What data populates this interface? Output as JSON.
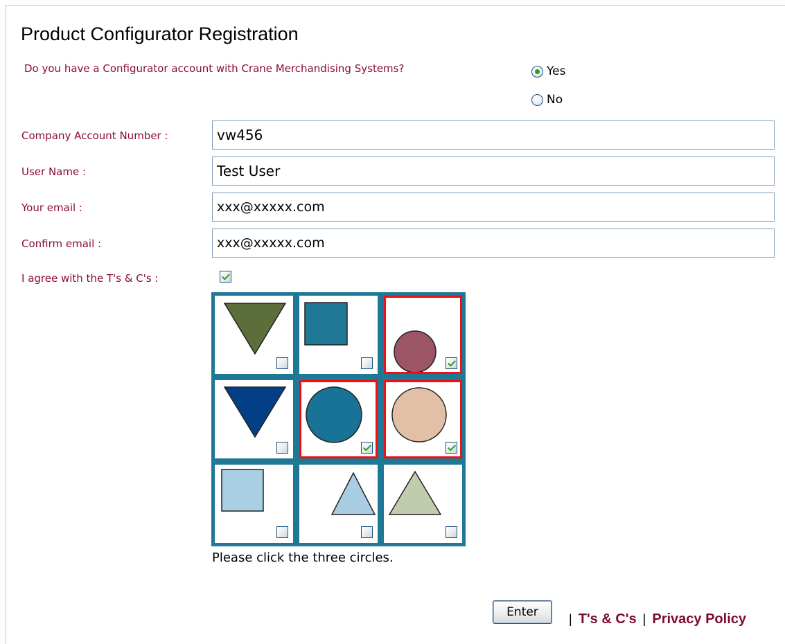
{
  "page": {
    "title": "Product Configurator Registration",
    "question": "Do you have a Configurator account with Crane Merchandising Systems?",
    "account_options": [
      {
        "label": "Yes",
        "selected": true
      },
      {
        "label": "No",
        "selected": false
      }
    ]
  },
  "form": {
    "company_account": {
      "label": "Company Account Number :",
      "value": "vw456"
    },
    "user_name": {
      "label": "User Name :",
      "value": "Test User"
    },
    "email": {
      "label": "Your email :",
      "value": "xxx@xxxxx.com"
    },
    "confirm_email": {
      "label": "Confirm email :",
      "value": "xxx@xxxxx.com"
    },
    "terms": {
      "label": "I agree with the T's & C's :",
      "checked": true
    }
  },
  "captcha": {
    "instruction": "Please click the three circles.",
    "cells": [
      {
        "shape": "triangle-down",
        "color": "#5c6e3a",
        "checked": false
      },
      {
        "shape": "square",
        "color": "#1f7896",
        "checked": false
      },
      {
        "shape": "circle",
        "color": "#9b5566",
        "checked": true
      },
      {
        "shape": "triangle-down",
        "color": "#033f86",
        "checked": false
      },
      {
        "shape": "circle",
        "color": "#197397",
        "checked": true
      },
      {
        "shape": "circle",
        "color": "#e2c0a8",
        "checked": true
      },
      {
        "shape": "square",
        "color": "#a9cfe3",
        "checked": false
      },
      {
        "shape": "triangle-up",
        "color": "#a9cde3",
        "checked": false
      },
      {
        "shape": "triangle-up",
        "color": "#c0ccac",
        "checked": false
      }
    ]
  },
  "footer": {
    "enter_label": "Enter",
    "separator": "|",
    "terms_link": "T's & C's",
    "privacy_link": "Privacy Policy"
  },
  "colors": {
    "label_text": "#8b0a3a",
    "grid_border": "#1f7896",
    "selected_border": "#ee1111",
    "check_mark": "#21a121",
    "link": "#7a0b32"
  }
}
